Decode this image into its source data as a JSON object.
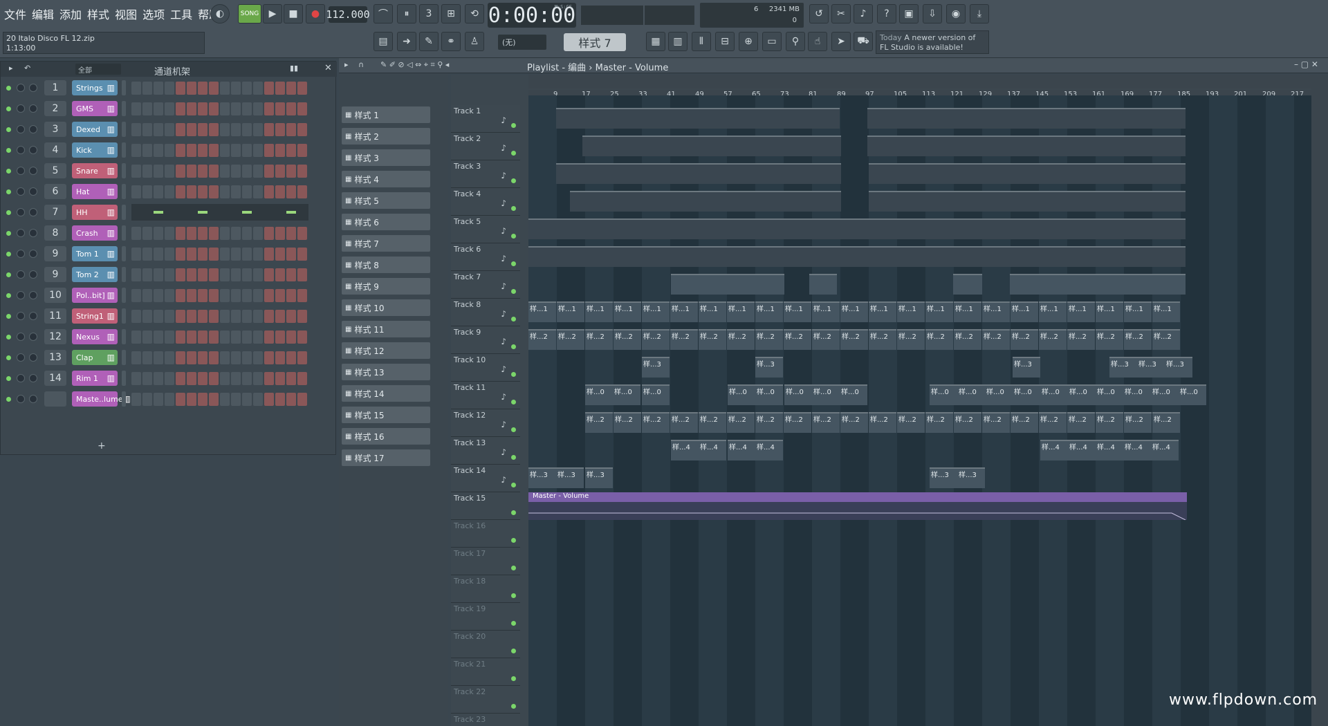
{
  "menu": [
    "文件",
    "编辑",
    "添加",
    "样式",
    "视图",
    "选项",
    "工具",
    "帮助"
  ],
  "transport": {
    "mode": "SONG",
    "tempo": "112.000",
    "time": "0:00:00",
    "time_unit": "M:S:CS",
    "pattern": "样式 7",
    "snap": "(无)"
  },
  "project": {
    "name": "20 Italo Disco FL 12.zip",
    "length": "1:13:00"
  },
  "meter": {
    "cpu": "6",
    "mem": "2341 MB",
    "voices": "0"
  },
  "news": {
    "when": "Today",
    "text": "A newer version of FL Studio is available!"
  },
  "rack": {
    "title": "通道机架",
    "filter": "全部",
    "channels": [
      {
        "num": "1",
        "name": "Strings",
        "color": "#5b8fb0"
      },
      {
        "num": "2",
        "name": "GMS",
        "color": "#b060b8"
      },
      {
        "num": "3",
        "name": "Dexed",
        "color": "#5b8fb0"
      },
      {
        "num": "4",
        "name": "Kick",
        "color": "#5b8fb0"
      },
      {
        "num": "5",
        "name": "Snare",
        "color": "#c06078"
      },
      {
        "num": "6",
        "name": "Hat",
        "color": "#b060b8"
      },
      {
        "num": "7",
        "name": "HH",
        "color": "#c06078"
      },
      {
        "num": "8",
        "name": "Crash",
        "color": "#b060b8"
      },
      {
        "num": "9",
        "name": "Tom 1",
        "color": "#5b8fb0"
      },
      {
        "num": "9",
        "name": "Tom 2",
        "color": "#5b8fb0"
      },
      {
        "num": "10",
        "name": "Pol..bit]",
        "color": "#b060b8"
      },
      {
        "num": "11",
        "name": "String1",
        "color": "#c06078"
      },
      {
        "num": "12",
        "name": "Nexus",
        "color": "#b060b8"
      },
      {
        "num": "13",
        "name": "Clap",
        "color": "#5fa060"
      },
      {
        "num": "14",
        "name": "Rim 1",
        "color": "#b060b8"
      },
      {
        "num": "",
        "name": "Maste..lume",
        "color": "#b060b8"
      }
    ]
  },
  "patterns": [
    "样式 1",
    "样式 2",
    "样式 3",
    "样式 4",
    "样式 5",
    "样式 6",
    "样式 7",
    "样式 8",
    "样式 9",
    "样式 10",
    "样式 11",
    "样式 12",
    "样式 13",
    "样式 14",
    "样式 15",
    "样式 16",
    "样式 17"
  ],
  "playlist": {
    "title": "Playlist - 编曲 › Master - Volume",
    "ruler": [
      "9",
      "17",
      "25",
      "33",
      "41",
      "49",
      "57",
      "65",
      "73",
      "81",
      "89",
      "97",
      "105",
      "113",
      "121",
      "129",
      "137",
      "145",
      "153",
      "161",
      "169",
      "177",
      "185",
      "193",
      "201",
      "209",
      "217"
    ],
    "tracks": [
      "Track 1",
      "Track 2",
      "Track 3",
      "Track 4",
      "Track 5",
      "Track 6",
      "Track 7",
      "Track 8",
      "Track 9",
      "Track 10",
      "Track 11",
      "Track 12",
      "Track 13",
      "Track 14",
      "Track 15",
      "Track 16",
      "Track 17",
      "Track 18",
      "Track 19",
      "Track 20",
      "Track 21",
      "Track 22",
      "Track 23"
    ],
    "automation_clip": "Master - Volume",
    "clip_labels": {
      "t8": "样...1",
      "t9": "样...2",
      "t10": "样...3",
      "t11": "样...0",
      "t12": "样...2",
      "t13": "样...4",
      "t14": "样...3"
    }
  },
  "watermark": "www.flpdown.com"
}
